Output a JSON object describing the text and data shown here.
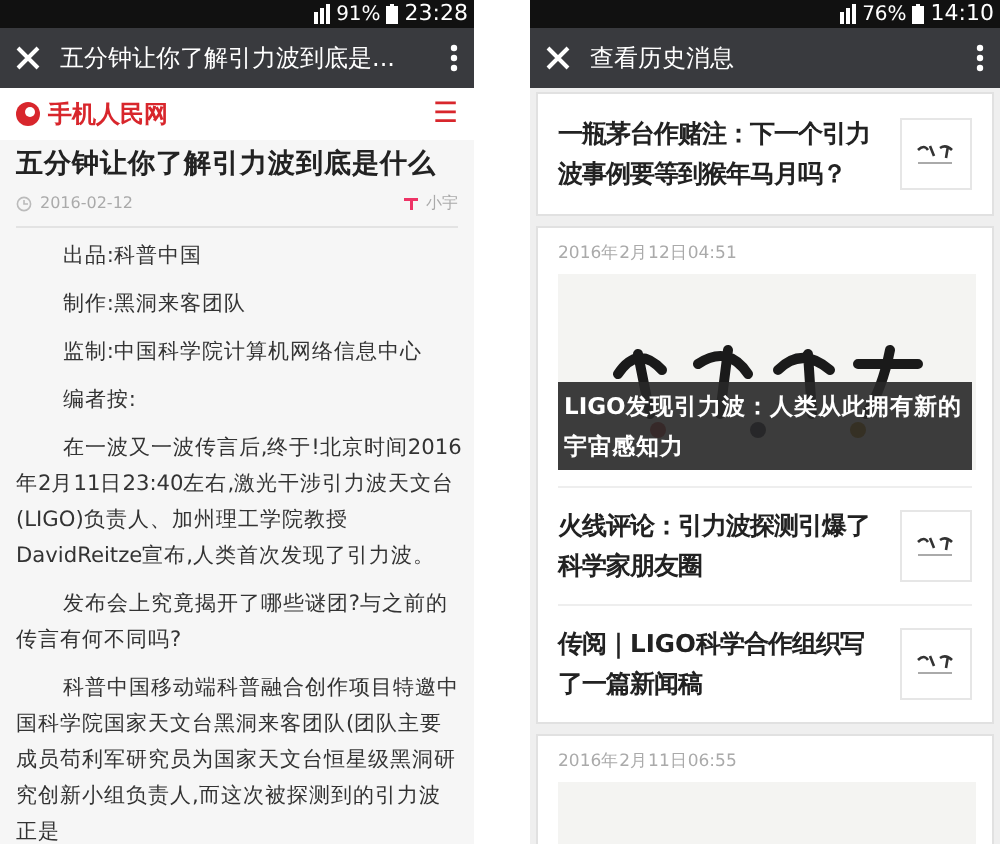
{
  "left_phone": {
    "status_bar": {
      "battery": "91%",
      "time": "23:28"
    },
    "title_bar": {
      "title": "五分钟让你了解引力波到底是..."
    },
    "site_header": {
      "logo_text": "手机人民网",
      "menu": "☰"
    },
    "article": {
      "title": "五分钟让你了解引力波到底是什么",
      "date": "2016-02-12",
      "author": "小宇",
      "paragraphs": [
        "出品:科普中国",
        "制作:黑洞来客团队",
        "监制:中国科学院计算机网络信息中心",
        "编者按:",
        "在一波又一波传言后,终于!北京时间2016年2月11日23:40左右,激光干涉引力波天文台(LIGO)负责人、加州理工学院教授DavidReitze宣布,人类首次发现了引力波。",
        "发布会上究竟揭开了哪些谜团?与之前的传言有何不同吗?",
        "科普中国移动端科普融合创作项目特邀中国科学院国家天文台黑洞来客团队(团队主要成员苟利军研究员为国家天文台恒星级黑洞研究创新小组负责人,而这次被探测到的引力波正是"
      ]
    }
  },
  "right_phone": {
    "status_bar": {
      "battery": "76%",
      "time": "14:10"
    },
    "title_bar": {
      "title": "查看历史消息"
    },
    "messages": [
      {
        "kind": "single",
        "title": "一瓶茅台作赌注：下一个引力波事例要等到猴年马月吗？"
      },
      {
        "kind": "group",
        "date": "2016年2月12日04:51",
        "cover_title": "LIGO发现引力波：人类从此拥有新的宇宙感知力",
        "items": [
          {
            "title": "火线评论：引力波探测引爆了科学家朋友圈"
          },
          {
            "title": "传阅｜LIGO科学合作组织写了一篇新闻稿"
          }
        ]
      },
      {
        "kind": "group",
        "date": "2016年2月11日06:55"
      }
    ]
  }
}
